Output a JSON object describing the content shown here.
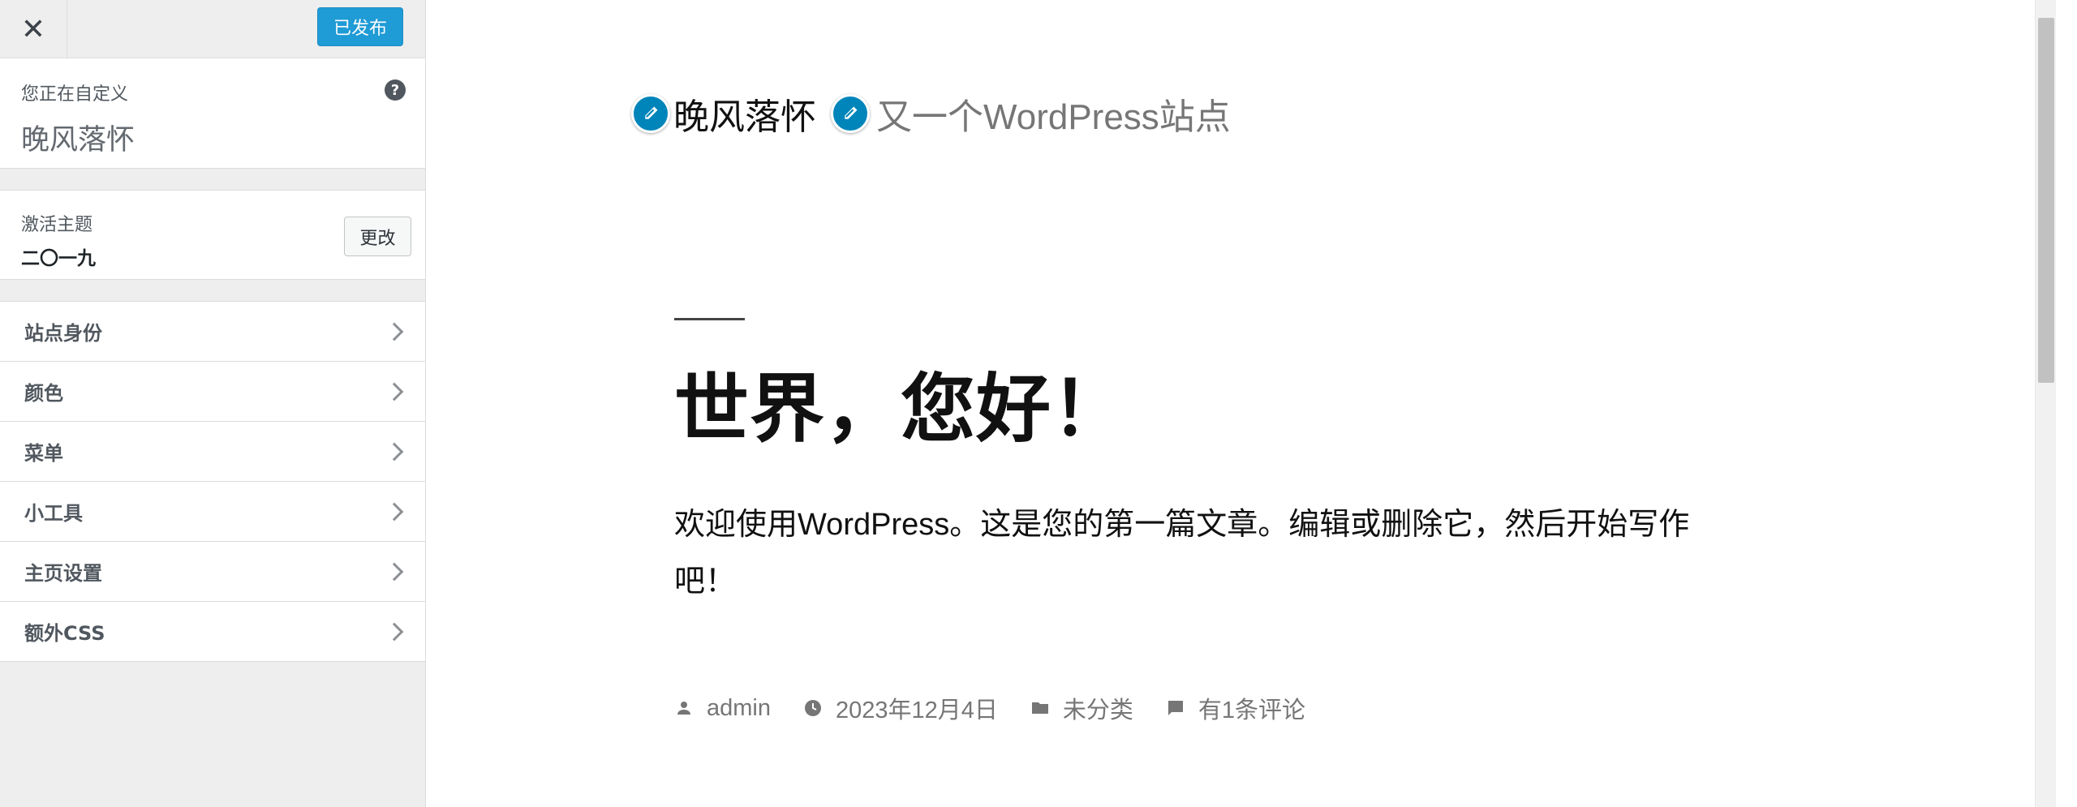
{
  "topbar": {
    "close_label": "✕",
    "publish_label": "已发布"
  },
  "info": {
    "customizing_label": "您正在自定义",
    "site_name": "晚风落怀",
    "help_icon": "?"
  },
  "theme": {
    "active_label": "激活主题",
    "name": "二〇一九",
    "change_label": "更改"
  },
  "menu": {
    "items": [
      {
        "label": "站点身份"
      },
      {
        "label": "颜色"
      },
      {
        "label": "菜单"
      },
      {
        "label": "小工具"
      },
      {
        "label": "主页设置"
      },
      {
        "label": "额外CSS"
      }
    ]
  },
  "preview": {
    "site_title": "晚风落怀",
    "site_description": "又一个WordPress站点",
    "post_title": "世界，您好！",
    "post_content": "欢迎使用WordPress。这是您的第一篇文章。编辑或删除它，然后开始写作吧！",
    "meta": {
      "author": "admin",
      "date": "2023年12月4日",
      "category": "未分类",
      "comments": "有1条评论"
    }
  },
  "colors": {
    "accent": "#0085ba",
    "publish_button": "#0e94d4",
    "sidebar_bg": "#eeeeee",
    "meta_text": "#767676"
  },
  "icons": {
    "close": "close-icon",
    "help": "help-icon",
    "chevron": "chevron-right-icon",
    "edit": "pencil-icon",
    "author": "person-icon",
    "date": "clock-icon",
    "category": "folder-icon",
    "comments": "comment-icon"
  }
}
